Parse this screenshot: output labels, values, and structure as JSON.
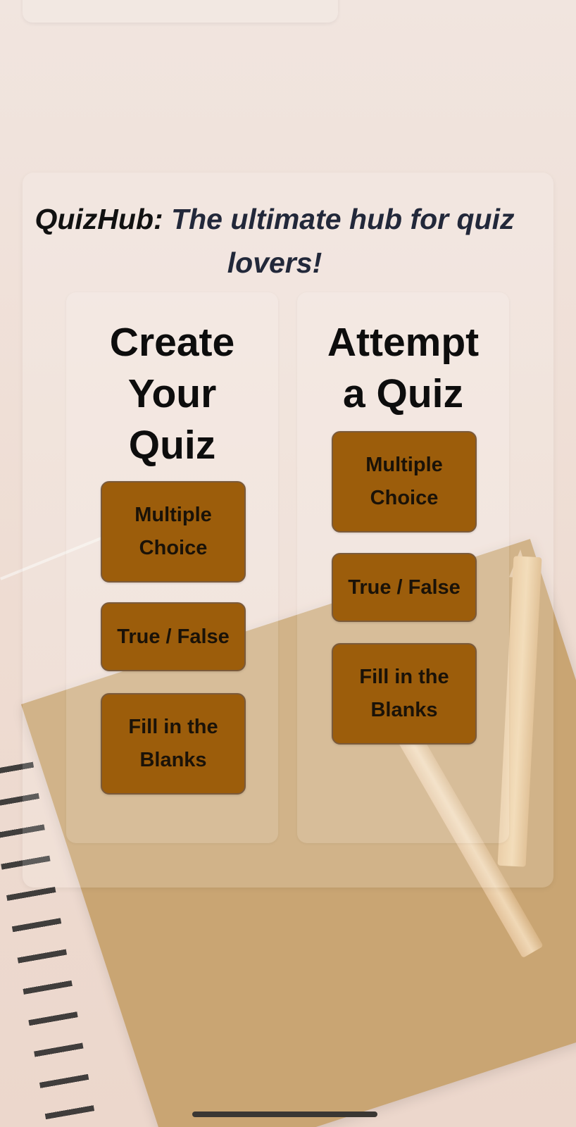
{
  "headline": {
    "brand": "QuizHub:",
    "tagline": "The ultimate hub for quiz lovers!"
  },
  "create_section": {
    "title": "Create Your Quiz",
    "buttons": {
      "multiple_choice": "Multiple Choice",
      "true_false": "True / False",
      "fill_blanks": "Fill in the Blanks"
    }
  },
  "attempt_section": {
    "title": "Attempt a Quiz",
    "buttons": {
      "multiple_choice": "Multiple Choice",
      "true_false": "True / False",
      "fill_blanks": "Fill in the Blanks"
    }
  },
  "colors": {
    "button_fill": "#9c5d0b",
    "headline_text": "#22283a"
  },
  "background": {
    "image_hint": "notebook-and-pencils-background"
  }
}
